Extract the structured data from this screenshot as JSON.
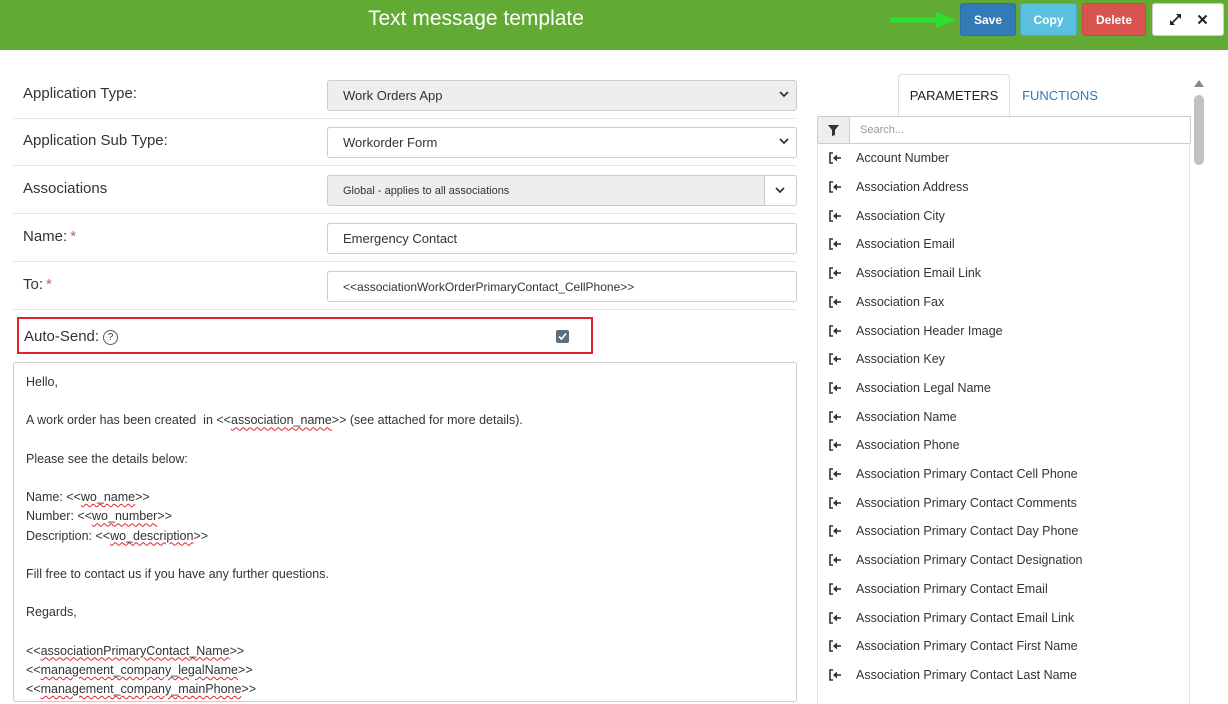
{
  "header": {
    "title": "Text message template",
    "save_label": "Save",
    "copy_label": "Copy",
    "delete_label": "Delete",
    "colors": {
      "bar": "#61ab35",
      "save": "#337ab7",
      "copy": "#5bc0de",
      "delete": "#d9534f",
      "arrow": "#2ee02e"
    }
  },
  "form": {
    "application_type": {
      "label": "Application Type:",
      "value": "Work Orders App"
    },
    "application_sub_type": {
      "label": "Application Sub Type:",
      "value": "Workorder Form"
    },
    "associations": {
      "label": "Associations",
      "value": "Global - applies to all associations"
    },
    "name": {
      "label": "Name:",
      "required": "*",
      "value": "Emergency Contact"
    },
    "to": {
      "label": "To:",
      "required": "*",
      "value": "<<associationWorkOrderPrimaryContact_CellPhone>>"
    },
    "auto_send": {
      "label": "Auto-Send:",
      "help": "?",
      "checked": true
    }
  },
  "editor": {
    "l1": "Hello,",
    "l2": "",
    "l3a": "A work order has been created  in <<",
    "l3b": "association_name",
    "l3c": ">> (see attached for more details).",
    "l4": "",
    "l5": "Please see the details below:",
    "l6": "",
    "l7a": "Name: <<",
    "l7b": "wo_name",
    "l7c": ">>",
    "l8a": "Number: <<",
    "l8b": "wo_number",
    "l8c": ">>",
    "l9a": "Description: <<",
    "l9b": "wo_description",
    "l9c": ">>",
    "l10": "",
    "l11": "Fill free to contact us if you have any further questions.",
    "l12": "",
    "l13": "Regards,",
    "l14": "",
    "l15a": "<<",
    "l15b": "associationPrimaryContact_Name",
    "l15c": ">>",
    "l16a": "<<",
    "l16b": "management_company_legalName",
    "l16c": ">>",
    "l17a": "<<",
    "l17b": "management_company_mainPhone",
    "l17c": ">>"
  },
  "panel": {
    "tabs": {
      "parameters": "PARAMETERS",
      "functions": "FUNCTIONS"
    },
    "search_placeholder": "Search...",
    "items": [
      "Account Number",
      "Association Address",
      "Association City",
      "Association Email",
      "Association Email Link",
      "Association Fax",
      "Association Header Image",
      "Association Key",
      "Association Legal Name",
      "Association Name",
      "Association Phone",
      "Association Primary Contact Cell Phone",
      "Association Primary Contact Comments",
      "Association Primary Contact Day Phone",
      "Association Primary Contact Designation",
      "Association Primary Contact Email",
      "Association Primary Contact Email Link",
      "Association Primary Contact First Name",
      "Association Primary Contact Last Name"
    ]
  }
}
